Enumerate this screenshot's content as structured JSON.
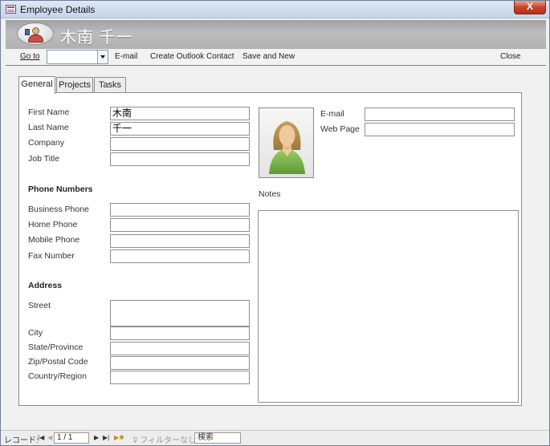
{
  "window": {
    "title": "Employee Details",
    "close_glyph": "X"
  },
  "header": {
    "employee_name": "木南 千一",
    "icon": "contact-card-icon"
  },
  "toolbar": {
    "goto_label": "Go to",
    "goto_value": "",
    "email_label": "E-mail",
    "outlook_label": "Create Outlook Contact",
    "save_new_label": "Save and New",
    "close_label": "Close"
  },
  "tabs": [
    {
      "label": "General",
      "active": true
    },
    {
      "label": "Projects",
      "active": false
    },
    {
      "label": "Tasks",
      "active": false
    }
  ],
  "general": {
    "first_name": {
      "label": "First Name",
      "value": "木南"
    },
    "last_name": {
      "label": "Last Name",
      "value": "千一"
    },
    "company": {
      "label": "Company",
      "value": ""
    },
    "job_title": {
      "label": "Job Title",
      "value": ""
    },
    "phone_section": "Phone Numbers",
    "business_phone": {
      "label": "Business Phone",
      "value": ""
    },
    "home_phone": {
      "label": "Home Phone",
      "value": ""
    },
    "mobile_phone": {
      "label": "Mobile Phone",
      "value": ""
    },
    "fax_number": {
      "label": "Fax Number",
      "value": ""
    },
    "address_section": "Address",
    "street": {
      "label": "Street",
      "value": ""
    },
    "city": {
      "label": "City",
      "value": ""
    },
    "state": {
      "label": "State/Province",
      "value": ""
    },
    "zip": {
      "label": "Zip/Postal Code",
      "value": ""
    },
    "country": {
      "label": "Country/Region",
      "value": ""
    },
    "email": {
      "label": "E-mail",
      "value": ""
    },
    "web_page": {
      "label": "Web Page",
      "value": ""
    },
    "notes_label": "Notes",
    "notes_value": ""
  },
  "statusbar": {
    "record_label": "レコード:",
    "record_value": "1 / 1",
    "filter_label": "フィルターなし",
    "search_label": "検索"
  },
  "colors": {
    "title_bar": "#c5d5ea",
    "header_band": "#b0b0b0",
    "close_button": "#c8432a"
  }
}
